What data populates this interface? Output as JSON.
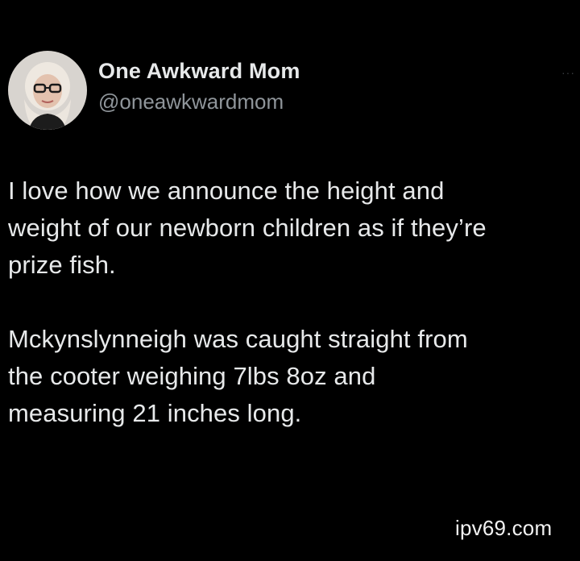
{
  "author": {
    "display_name": "One Awkward Mom",
    "handle": "@oneawkwardmom",
    "avatar_icon": "profile-photo"
  },
  "tweet": {
    "paragraphs": [
      "I love how we announce the height and\nweight of our newborn children as if they’re\nprize fish.",
      "Mckynslynneigh was caught straight from\nthe cooter weighing 7lbs 8oz and\nmeasuring 21 inches long."
    ]
  },
  "menu": {
    "icon": "more-options-icon",
    "glyph": "···"
  },
  "watermark": {
    "text": "ipv69.com"
  },
  "colors": {
    "background": "#000000",
    "primary_text": "#e7e9ea",
    "secondary_text": "#8f959a"
  }
}
